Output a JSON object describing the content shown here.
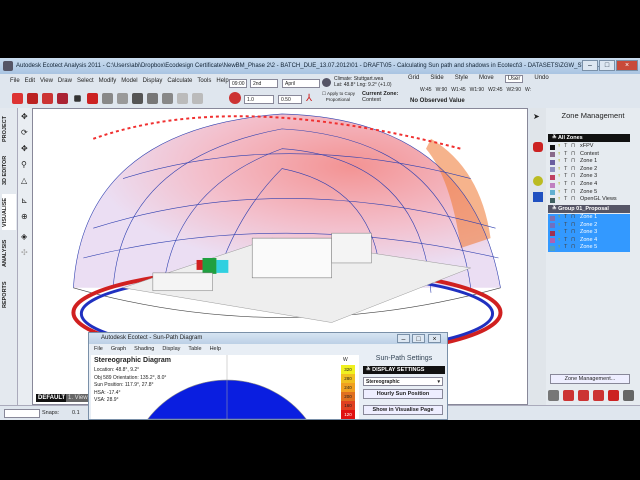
{
  "window": {
    "title": "Autodesk Ecotect Analysis 2011 - C:\\Users\\abi\\Dropbox\\Ecodesign Certificate\\NewBM_Phase 2\\2 - BATCH_DUE_13.07.2012\\01 - DRAFT\\05 - Calculating Sun path and shadows in Ecotect\\3 - DATASETS\\ZGW_STUTT..."
  },
  "menu": [
    "File",
    "Edit",
    "View",
    "Draw",
    "Select",
    "Modify",
    "Model",
    "Display",
    "Calculate",
    "Tools",
    "Help"
  ],
  "time": {
    "time": "09:00",
    "day": "2nd",
    "month": "April",
    "scale1": "1.0",
    "scale2": "0.50"
  },
  "climate": {
    "label": "Climate: Stuttgart.wea",
    "latlon": "Lat: 48.8° Lng: 9.2° (+1.0)",
    "apply_label": "Apply to Copy",
    "proportional_label": "Proportional",
    "current_zone_label": "Current Zone:",
    "current_zone": "Context"
  },
  "view_tabs": [
    "Grid",
    "Slide",
    "Style",
    "Move",
    "User",
    "Undo"
  ],
  "view_buttons": [
    "W:45",
    "W:90",
    "W1:45",
    "W1:90",
    "W2:45",
    "W2:90",
    "W:"
  ],
  "observed": "No Observed Value",
  "left_tabs": [
    "PROJECT",
    "3D EDITOR",
    "VISUALISE",
    "ANALYSIS",
    "REPORTS"
  ],
  "zone_panel": {
    "title": "Zone Management",
    "all_zones": "All Zones",
    "zones": [
      "xFPV",
      "Context",
      "Zone 1",
      "Zone 2",
      "Zone 3",
      "Zone 4",
      "Zone 5",
      "OpenGL Views"
    ],
    "group": "Group 01_Proposal",
    "group_zones": [
      "Zone 1",
      "Zone 2",
      "Zone 3",
      "Zone 4",
      "Zone 5"
    ],
    "button": "Zone Management..."
  },
  "zone_colors": [
    "#111111",
    "#8a6a8a",
    "#6a5fa0",
    "#9090c0",
    "#c04060",
    "#c080c0",
    "#60b0d0",
    "#406060"
  ],
  "group_colors": [
    "#8070b0",
    "#7070c0",
    "#a03050",
    "#b060b0",
    "#50a0c0"
  ],
  "status": {
    "view_label": "DEFAULT",
    "view2": "1. View",
    "snaps": "Snaps:",
    "snap_val": "0.1"
  },
  "sunpath": {
    "title": "Autodesk Ecotect - Sun-Path Diagram",
    "menu": [
      "File",
      "Graph",
      "Shading",
      "Display",
      "Table",
      "Help"
    ],
    "diagram_title": "Stereographic Diagram",
    "location": "Location: 48.8°, 9.2°",
    "orientation": "Obj 589 Orientation: 135.2°, 8.0°",
    "sun_position": "Sun Position: 117.9°, 27.8°",
    "hsa": "HSA: -17.4°",
    "vsa": "VSA: 28.9°",
    "settings_title": "Sun-Path Settings",
    "display_settings": "DISPLAY SETTINGS",
    "projection": "Stereographic",
    "hourly_btn": "Hourly Sun Position",
    "show_btn": "Show in Visualise Page",
    "legend_unit": "W",
    "legend_values": [
      "320",
      "280",
      "240",
      "200",
      "160",
      "120"
    ]
  }
}
